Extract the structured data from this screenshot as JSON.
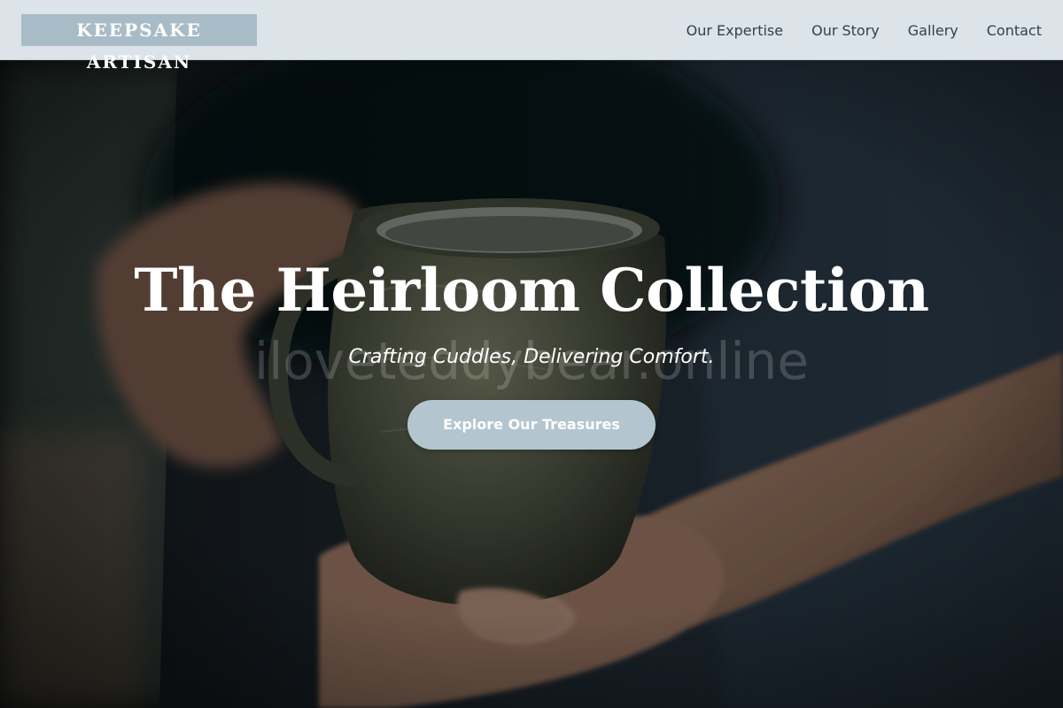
{
  "brand": {
    "name": "KEEPSAKE ARTISAN",
    "accent_color": "#a8bcc7"
  },
  "nav": {
    "items": [
      {
        "label": "Our Expertise"
      },
      {
        "label": "Our Story"
      },
      {
        "label": "Gallery"
      },
      {
        "label": "Contact"
      }
    ]
  },
  "hero": {
    "title": "The Heirloom Collection",
    "watermark": "iloveteddybear.online",
    "tagline": "Crafting Cuddles, Delivering Comfort.",
    "cta_label": "Explore Our Treasures",
    "cta_color": "#b3c6cf",
    "image": "hands-holding-ceramic-mug-photo"
  }
}
